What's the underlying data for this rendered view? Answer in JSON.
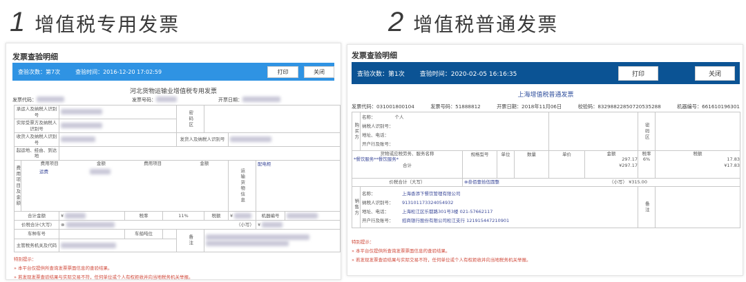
{
  "left": {
    "heading_num": "1",
    "heading_text": "增值税专用发票",
    "panel_title": "发票查验明细",
    "check_count": "查验次数：第7次",
    "check_time": "查验时间：2016-12-20 17:02:59",
    "print": "打印",
    "close": "关闭",
    "invoice_title": "河北货物运输业增值税专用发票",
    "code_label": "发票代码：",
    "number_label": "发票号码：",
    "date_label": "开票日期：",
    "carrier": "承运人及纳税人识别号",
    "actual_recipient": "实际受票方及纳税人识别号",
    "consignee": "收货人及纳税人识别号",
    "consignor": "发货人及纳税人识别号",
    "password_area": "密码区",
    "route": "起运地、经由、到达地",
    "fee_items": "费用项目及金额",
    "fee_item_h": "费用项目",
    "amount_h": "金额",
    "fee_item_1": "运费",
    "cargo_info": "运输货物信息",
    "cargo_value": "配电柜",
    "total_amount": "合计金额",
    "yen": "¥",
    "tax_rate": "税率",
    "tax_rate_value": "11%",
    "tax": "税额",
    "machine_no": "机器编号",
    "total_tax_upper": "价税合计(大写)",
    "circle_x": "⊗",
    "lower": "（小写）",
    "vehicle": "车种车号",
    "tonnage": "车船吨位",
    "remarks": "备注",
    "tax_authority": "主管税务机关及代码",
    "tips_title": "特别提示：",
    "tip1": "本平台仅提供所查询发票票面信息的查验结果。",
    "tip2": "若发现发票查验结果与实际交易不符，任何单位或个人有权拒收并向当地税务机关举报。"
  },
  "right": {
    "heading_num": "2",
    "heading_text": "增值税普通发票",
    "panel_title": "发票查验明细",
    "check_count": "查验次数：第1次",
    "check_time": "查验时间：2020-02-05 16:16:35",
    "print": "打印",
    "close": "关闭",
    "invoice_title": "上海增值税普通发票",
    "code": "发票代码：031001800104",
    "number": "发票号码：51888812",
    "date": "开票日期：2018年11月06日",
    "check_code": "校验码：83298822850720535288",
    "machine": "机器编号：661610196301",
    "buyer": "购买方",
    "name_label": "名称：",
    "buyer_name": "个人",
    "taxid_label": "纳税人识别号：",
    "addr_label": "地址、电话：",
    "bank_label": "开户行及账号：",
    "password_area": "密码区",
    "cols": [
      "货物或应税劳务、服务名称",
      "规格型号",
      "单位",
      "数量",
      "单价",
      "金额",
      "税率",
      "税额"
    ],
    "item": {
      "name": "*餐饮服务**餐饮服务*",
      "amount": "297.17",
      "rate": "6%",
      "tax": "17.83"
    },
    "subtotal_label": "合计",
    "subtotal_amount": "¥297.17",
    "subtotal_tax": "¥17.83",
    "total_upper_label": "价税合计（大写）",
    "total_upper": "⊗叁佰壹拾伍圆整",
    "lower_label": "（小写）",
    "total_lower": "¥315.00",
    "seller": "销售方",
    "seller_name": "上海香添下餐饮管理有限公司",
    "seller_taxid": "913101173324054932",
    "seller_addr": "上海松江区乐都路301号3楼 021-57662117",
    "seller_bank": "招商银行股份有限公司松江支行 121915447210901",
    "remarks": "备注",
    "tips_title": "特别提示：",
    "tip1": "本平台仅提供所查询发票票面信息的查验结果。",
    "tip2": "若发现发票查验结果与实际交易不符，任何单位或个人有权拒收并向当地税务机关举报。"
  }
}
